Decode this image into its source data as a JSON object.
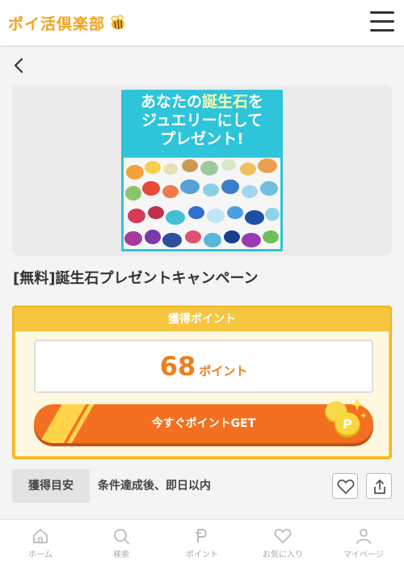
{
  "header": {
    "logo_text": "ポイ活倶楽部",
    "logo_icon": "bee-icon",
    "menu_icon": "hamburger-icon"
  },
  "nav": {
    "back_icon": "chevron-left-icon"
  },
  "banner": {
    "line1_pre": "あなたの",
    "line1_hl": "誕生石",
    "line1_post": "を",
    "line2": "ジュエリーにして",
    "line3": "プレゼント!"
  },
  "campaign": {
    "title": "[無料]誕生石プレゼントキャンペーン"
  },
  "points": {
    "header": "獲得ポイント",
    "value": "68",
    "unit": "ポイント",
    "get_button": "今すぐポイントGET"
  },
  "estimate": {
    "label": "獲得目安",
    "value": "条件達成後、即日以内"
  },
  "actions": {
    "favorite_icon": "heart-icon",
    "share_icon": "share-icon"
  },
  "bottom_nav": {
    "home": "ホーム",
    "search": "検索",
    "points": "ポイント",
    "favorites": "お気に入り",
    "mypage": "マイページ"
  },
  "colors": {
    "accent": "#f37021",
    "panel": "#f7c640",
    "banner": "#2ec4d9",
    "brand": "#f3a21c"
  }
}
